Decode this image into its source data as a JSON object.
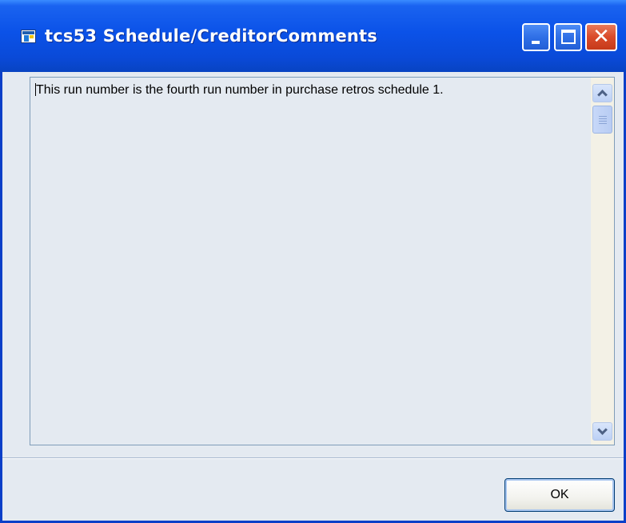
{
  "window": {
    "title": "tcs53 Schedule/CreditorComments",
    "icon": "app-window-icon",
    "controls": {
      "minimize_icon": "minimize-icon",
      "maximize_icon": "maximize-icon",
      "close_icon": "close-icon",
      "close_glyph": "✕"
    }
  },
  "comments": {
    "text": "This run number is the fourth run number in purchase retros schedule 1."
  },
  "footer": {
    "ok_label": "OK"
  },
  "colors": {
    "titlebar": "#0b52e8",
    "client_bg": "#e4eaf1",
    "close_button": "#d94a2a"
  }
}
